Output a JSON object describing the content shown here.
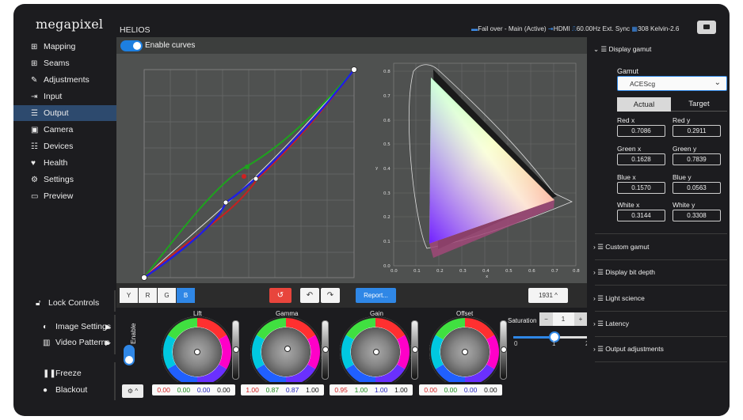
{
  "app": {
    "brand": "megapixel",
    "title": "HELIOS",
    "status": {
      "failover": "Fail over - Main (Active)",
      "input": "HDMI",
      "sync": "60.00Hz Ext. Sync",
      "color": "308 Kelvin-2.6"
    }
  },
  "sidebar": {
    "items": [
      {
        "label": "Mapping",
        "icon": "grid-icon"
      },
      {
        "label": "Seams",
        "icon": "plus-square-icon"
      },
      {
        "label": "Adjustments",
        "icon": "brush-icon"
      },
      {
        "label": "Input",
        "icon": "input-arrow-icon"
      },
      {
        "label": "Output",
        "icon": "sliders-icon",
        "active": true
      },
      {
        "label": "Camera",
        "icon": "film-icon"
      },
      {
        "label": "Devices",
        "icon": "list-icon"
      },
      {
        "label": "Health",
        "icon": "heart-icon"
      },
      {
        "label": "Settings",
        "icon": "cogs-icon"
      },
      {
        "label": "Preview",
        "icon": "monitor-icon"
      }
    ],
    "lock_controls": "Lock Controls",
    "image_settings": "Image Settings",
    "video_patterns": "Video Patterns",
    "freeze": "Freeze",
    "blackout": "Blackout"
  },
  "curves": {
    "enable_label": "Enable curves",
    "enabled": true,
    "channels": [
      "Y",
      "R",
      "G",
      "B"
    ],
    "selected_channel": "B",
    "report_label": "Report...",
    "cie_mode": "1931",
    "undo_icon": "undo-icon",
    "redo_icon": "redo-icon",
    "reset_icon": "reset-icon"
  },
  "cie_chart": {
    "xlabel": "x",
    "ylabel": "y",
    "x_ticks": [
      "0.0",
      "0.1",
      "0.2",
      "0.3",
      "0.4",
      "0.5",
      "0.6",
      "0.7",
      "0.8"
    ],
    "y_ticks": [
      "0.0",
      "0.1",
      "0.2",
      "0.3",
      "0.4",
      "0.5",
      "0.6",
      "0.7",
      "0.8"
    ]
  },
  "grading": {
    "enable_label": "Enable",
    "wheels": [
      {
        "name": "Lift",
        "values": [
          "0.00",
          "0.00",
          "0.00",
          "0.00"
        ]
      },
      {
        "name": "Gamma",
        "values": [
          "1.00",
          "0.87",
          "0.87",
          "1.00"
        ]
      },
      {
        "name": "Gain",
        "values": [
          "0.95",
          "1.00",
          "1.00",
          "1.00"
        ]
      },
      {
        "name": "Offset",
        "values": [
          "0.00",
          "0.00",
          "0.00",
          "0.00"
        ]
      }
    ],
    "saturation_label": "Saturation",
    "saturation_value": "1",
    "saturation_slider": 1,
    "saturation_ticks": [
      "0",
      "1",
      "2"
    ],
    "minus": "−",
    "plus": "+"
  },
  "right_panel": {
    "display_gamut": "Display gamut",
    "gamut_label": "Gamut",
    "gamut_value": "ACEScg",
    "tab_actual": "Actual",
    "tab_target": "Target",
    "red_x_label": "Red x",
    "red_x": "0.7086",
    "red_y_label": "Red y",
    "red_y": "0.2911",
    "green_x_label": "Green x",
    "green_x": "0.1628",
    "green_y_label": "Green y",
    "green_y": "0.7839",
    "blue_x_label": "Blue x",
    "blue_x": "0.1570",
    "blue_y_label": "Blue y",
    "blue_y": "0.0563",
    "white_x_label": "White x",
    "white_x": "0.3144",
    "white_y_label": "White y",
    "white_y": "0.3308",
    "custom_gamut": "Custom gamut",
    "display_bit_depth": "Display bit depth",
    "light_science": "Light science",
    "latency": "Latency",
    "output_adjustments": "Output adjustments"
  },
  "colors": {
    "accent": "#2f87e6",
    "active_nav": "#2d4a6e",
    "danger": "#e8453c"
  }
}
